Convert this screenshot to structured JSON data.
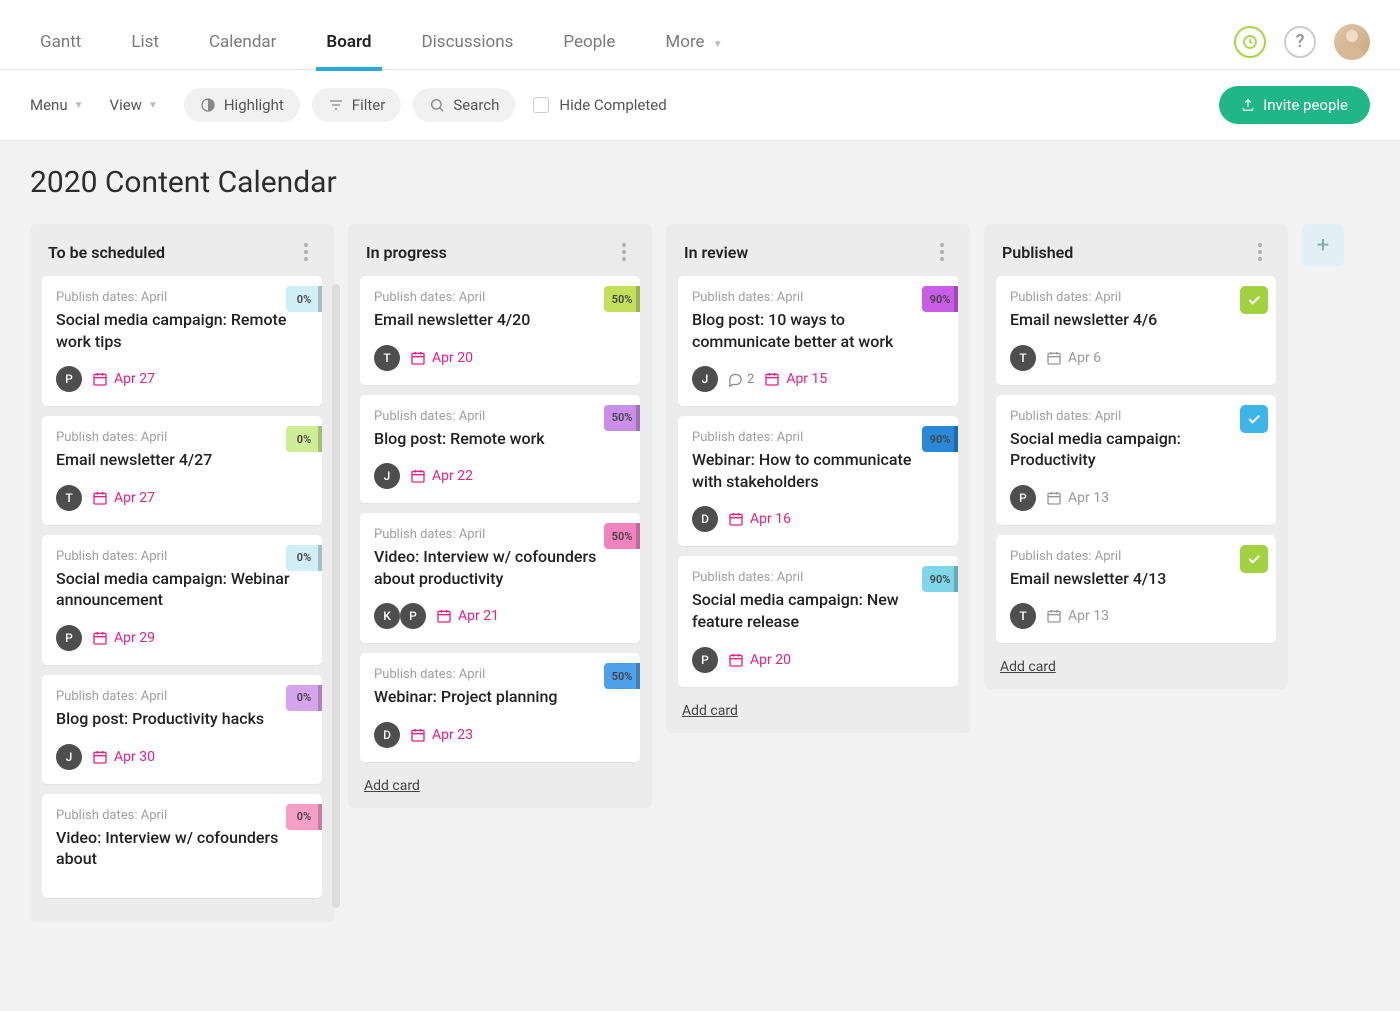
{
  "tabs": {
    "gantt": "Gantt",
    "list": "List",
    "calendar": "Calendar",
    "board": "Board",
    "discussions": "Discussions",
    "people": "People",
    "more": "More"
  },
  "toolbar": {
    "menu": "Menu",
    "view": "View",
    "highlight": "Highlight",
    "filter": "Filter",
    "search": "Search",
    "hide_completed": "Hide Completed",
    "invite": "Invite people"
  },
  "page_title": "2020 Content Calendar",
  "add_card_label": "Add card",
  "columns": [
    {
      "title": "To be scheduled",
      "scroll": true,
      "cards": [
        {
          "meta": "Publish dates: April",
          "title": "Social media campaign: Remote work tips",
          "avatars": [
            "P"
          ],
          "date": "Apr 27",
          "date_color": "pink",
          "badge": {
            "text": "0%",
            "bg": "#cfeef5"
          }
        },
        {
          "meta": "Publish dates: April",
          "title": "Email newsletter 4/27",
          "avatars": [
            "T"
          ],
          "date": "Apr 27",
          "date_color": "pink",
          "badge": {
            "text": "0%",
            "bg": "#cdee96"
          }
        },
        {
          "meta": "Publish dates: April",
          "title": "Social media campaign: Webinar announcement",
          "avatars": [
            "P"
          ],
          "date": "Apr 29",
          "date_color": "pink",
          "badge": {
            "text": "0%",
            "bg": "#cfeef5"
          }
        },
        {
          "meta": "Publish dates: April",
          "title": "Blog post: Productivity hacks",
          "avatars": [
            "J"
          ],
          "date": "Apr 30",
          "date_color": "pink",
          "badge": {
            "text": "0%",
            "bg": "#d6a3ec"
          }
        },
        {
          "meta": "Publish dates: April",
          "title": "Video: Interview w/ cofounders about",
          "avatars": [],
          "date": "",
          "date_color": "pink",
          "badge": {
            "text": "0%",
            "bg": "#f59ec7"
          }
        }
      ]
    },
    {
      "title": "In progress",
      "cards": [
        {
          "meta": "Publish dates: April",
          "title": "Email newsletter 4/20",
          "avatars": [
            "T"
          ],
          "date": "Apr 20",
          "date_color": "pink",
          "badge": {
            "text": "50%",
            "bg": "#c2e05b"
          }
        },
        {
          "meta": "Publish dates: April",
          "title": "Blog post: Remote work",
          "avatars": [
            "J"
          ],
          "date": "Apr 22",
          "date_color": "pink",
          "badge": {
            "text": "50%",
            "bg": "#c88ee8"
          }
        },
        {
          "meta": "Publish dates: April",
          "title": "Video: Interview w/ cofounders about productivity",
          "avatars": [
            "K",
            "P"
          ],
          "date": "Apr 21",
          "date_color": "pink",
          "badge": {
            "text": "50%",
            "bg": "#f082bd"
          }
        },
        {
          "meta": "Publish dates: April",
          "title": "Webinar: Project planning",
          "avatars": [
            "D"
          ],
          "date": "Apr 23",
          "date_color": "pink",
          "badge": {
            "text": "50%",
            "bg": "#4ea0ea"
          }
        }
      ],
      "add": true
    },
    {
      "title": "In review",
      "cards": [
        {
          "meta": "Publish dates: April",
          "title": "Blog post: 10 ways to communicate better at work",
          "avatars": [
            "J"
          ],
          "comments": "2",
          "date": "Apr 15",
          "date_color": "pink",
          "badge": {
            "text": "90%",
            "bg": "#c95de6"
          }
        },
        {
          "meta": "Publish dates: April",
          "title": "Webinar: How to communicate with stakeholders",
          "avatars": [
            "D"
          ],
          "date": "Apr 16",
          "date_color": "pink",
          "badge": {
            "text": "90%",
            "bg": "#2a88d8"
          }
        },
        {
          "meta": "Publish dates: April",
          "title": "Social media campaign: New feature release",
          "avatars": [
            "P"
          ],
          "date": "Apr 20",
          "date_color": "pink",
          "badge": {
            "text": "90%",
            "bg": "#7fd6e8"
          }
        }
      ],
      "add": true
    },
    {
      "title": "Published",
      "cards": [
        {
          "meta": "Publish dates: April",
          "title": "Email newsletter 4/6",
          "avatars": [
            "T"
          ],
          "date": "Apr 6",
          "date_color": "gray",
          "badge": {
            "done": true,
            "bg": "#a2d142"
          }
        },
        {
          "meta": "Publish dates: April",
          "title": "Social media campaign: Productivity",
          "avatars": [
            "P"
          ],
          "date": "Apr 13",
          "date_color": "gray",
          "badge": {
            "done": true,
            "bg": "#3db5e8"
          }
        },
        {
          "meta": "Publish dates: April",
          "title": "Email newsletter 4/13",
          "avatars": [
            "T"
          ],
          "date": "Apr 13",
          "date_color": "gray",
          "badge": {
            "done": true,
            "bg": "#a2d142"
          }
        }
      ],
      "add": true
    }
  ]
}
